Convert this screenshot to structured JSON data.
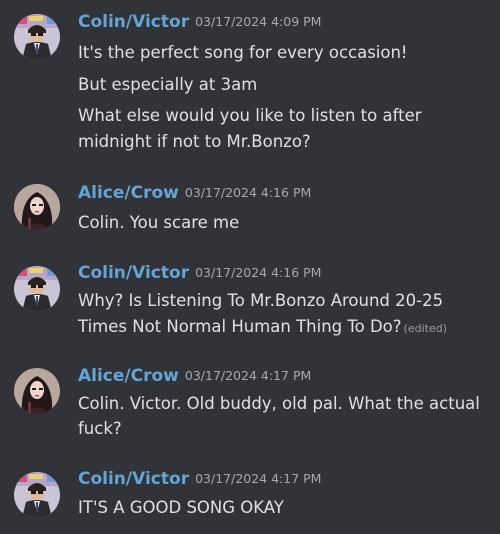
{
  "colors": {
    "background": "#313338",
    "username": "#63a5d5",
    "text": "#dfe1e4",
    "timestamp": "#a6a9ad"
  },
  "groups": [
    {
      "author": "Colin/Victor",
      "avatar_icon": "colin-avatar-icon",
      "timestamp": "03/17/2024 4:09 PM",
      "lines": [
        "It's the perfect song for every occasion!",
        "But especially at 3am",
        "What else would you like to listen to after",
        "midnight if not to Mr.Bonzo?"
      ]
    },
    {
      "author": "Alice/Crow",
      "avatar_icon": "alice-avatar-icon",
      "timestamp": "03/17/2024 4:16 PM",
      "lines": [
        "Colin. You scare me"
      ]
    },
    {
      "author": "Colin/Victor",
      "avatar_icon": "colin-avatar-icon",
      "timestamp": "03/17/2024 4:16 PM",
      "lines": [
        "Why? Is Listening To Mr.Bonzo Around 20-25",
        "Times Not Normal Human Thing To Do?"
      ],
      "edited_label": "(edited)"
    },
    {
      "author": "Alice/Crow",
      "avatar_icon": "alice-avatar-icon",
      "timestamp": "03/17/2024 4:17 PM",
      "lines": [
        "Colin. Victor. Old buddy, old pal. What the actual",
        "fuck?"
      ]
    },
    {
      "author": "Colin/Victor",
      "avatar_icon": "colin-avatar-icon",
      "timestamp": "03/17/2024 4:17 PM",
      "lines": [
        "IT'S A GOOD SONG OKAY"
      ]
    }
  ]
}
